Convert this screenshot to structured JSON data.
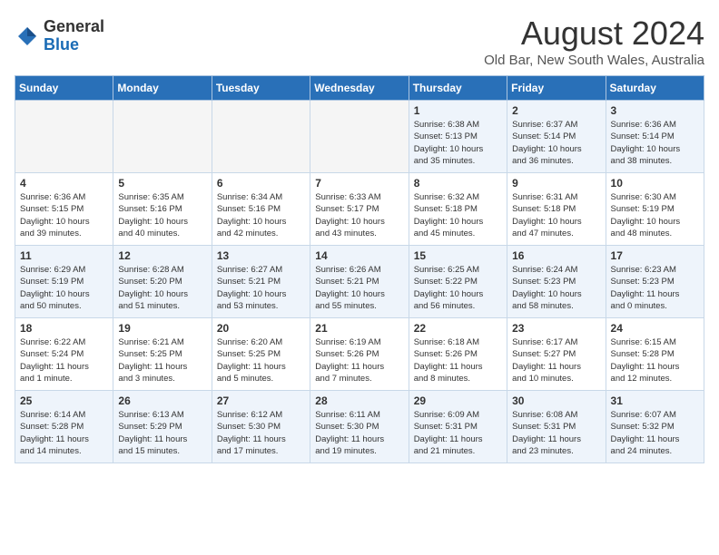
{
  "header": {
    "logo_general": "General",
    "logo_blue": "Blue",
    "month_year": "August 2024",
    "location": "Old Bar, New South Wales, Australia"
  },
  "weekdays": [
    "Sunday",
    "Monday",
    "Tuesday",
    "Wednesday",
    "Thursday",
    "Friday",
    "Saturday"
  ],
  "weeks": [
    [
      {
        "day": "",
        "info": ""
      },
      {
        "day": "",
        "info": ""
      },
      {
        "day": "",
        "info": ""
      },
      {
        "day": "",
        "info": ""
      },
      {
        "day": "1",
        "info": "Sunrise: 6:38 AM\nSunset: 5:13 PM\nDaylight: 10 hours\nand 35 minutes."
      },
      {
        "day": "2",
        "info": "Sunrise: 6:37 AM\nSunset: 5:14 PM\nDaylight: 10 hours\nand 36 minutes."
      },
      {
        "day": "3",
        "info": "Sunrise: 6:36 AM\nSunset: 5:14 PM\nDaylight: 10 hours\nand 38 minutes."
      }
    ],
    [
      {
        "day": "4",
        "info": "Sunrise: 6:36 AM\nSunset: 5:15 PM\nDaylight: 10 hours\nand 39 minutes."
      },
      {
        "day": "5",
        "info": "Sunrise: 6:35 AM\nSunset: 5:16 PM\nDaylight: 10 hours\nand 40 minutes."
      },
      {
        "day": "6",
        "info": "Sunrise: 6:34 AM\nSunset: 5:16 PM\nDaylight: 10 hours\nand 42 minutes."
      },
      {
        "day": "7",
        "info": "Sunrise: 6:33 AM\nSunset: 5:17 PM\nDaylight: 10 hours\nand 43 minutes."
      },
      {
        "day": "8",
        "info": "Sunrise: 6:32 AM\nSunset: 5:18 PM\nDaylight: 10 hours\nand 45 minutes."
      },
      {
        "day": "9",
        "info": "Sunrise: 6:31 AM\nSunset: 5:18 PM\nDaylight: 10 hours\nand 47 minutes."
      },
      {
        "day": "10",
        "info": "Sunrise: 6:30 AM\nSunset: 5:19 PM\nDaylight: 10 hours\nand 48 minutes."
      }
    ],
    [
      {
        "day": "11",
        "info": "Sunrise: 6:29 AM\nSunset: 5:19 PM\nDaylight: 10 hours\nand 50 minutes."
      },
      {
        "day": "12",
        "info": "Sunrise: 6:28 AM\nSunset: 5:20 PM\nDaylight: 10 hours\nand 51 minutes."
      },
      {
        "day": "13",
        "info": "Sunrise: 6:27 AM\nSunset: 5:21 PM\nDaylight: 10 hours\nand 53 minutes."
      },
      {
        "day": "14",
        "info": "Sunrise: 6:26 AM\nSunset: 5:21 PM\nDaylight: 10 hours\nand 55 minutes."
      },
      {
        "day": "15",
        "info": "Sunrise: 6:25 AM\nSunset: 5:22 PM\nDaylight: 10 hours\nand 56 minutes."
      },
      {
        "day": "16",
        "info": "Sunrise: 6:24 AM\nSunset: 5:23 PM\nDaylight: 10 hours\nand 58 minutes."
      },
      {
        "day": "17",
        "info": "Sunrise: 6:23 AM\nSunset: 5:23 PM\nDaylight: 11 hours\nand 0 minutes."
      }
    ],
    [
      {
        "day": "18",
        "info": "Sunrise: 6:22 AM\nSunset: 5:24 PM\nDaylight: 11 hours\nand 1 minute."
      },
      {
        "day": "19",
        "info": "Sunrise: 6:21 AM\nSunset: 5:25 PM\nDaylight: 11 hours\nand 3 minutes."
      },
      {
        "day": "20",
        "info": "Sunrise: 6:20 AM\nSunset: 5:25 PM\nDaylight: 11 hours\nand 5 minutes."
      },
      {
        "day": "21",
        "info": "Sunrise: 6:19 AM\nSunset: 5:26 PM\nDaylight: 11 hours\nand 7 minutes."
      },
      {
        "day": "22",
        "info": "Sunrise: 6:18 AM\nSunset: 5:26 PM\nDaylight: 11 hours\nand 8 minutes."
      },
      {
        "day": "23",
        "info": "Sunrise: 6:17 AM\nSunset: 5:27 PM\nDaylight: 11 hours\nand 10 minutes."
      },
      {
        "day": "24",
        "info": "Sunrise: 6:15 AM\nSunset: 5:28 PM\nDaylight: 11 hours\nand 12 minutes."
      }
    ],
    [
      {
        "day": "25",
        "info": "Sunrise: 6:14 AM\nSunset: 5:28 PM\nDaylight: 11 hours\nand 14 minutes."
      },
      {
        "day": "26",
        "info": "Sunrise: 6:13 AM\nSunset: 5:29 PM\nDaylight: 11 hours\nand 15 minutes."
      },
      {
        "day": "27",
        "info": "Sunrise: 6:12 AM\nSunset: 5:30 PM\nDaylight: 11 hours\nand 17 minutes."
      },
      {
        "day": "28",
        "info": "Sunrise: 6:11 AM\nSunset: 5:30 PM\nDaylight: 11 hours\nand 19 minutes."
      },
      {
        "day": "29",
        "info": "Sunrise: 6:09 AM\nSunset: 5:31 PM\nDaylight: 11 hours\nand 21 minutes."
      },
      {
        "day": "30",
        "info": "Sunrise: 6:08 AM\nSunset: 5:31 PM\nDaylight: 11 hours\nand 23 minutes."
      },
      {
        "day": "31",
        "info": "Sunrise: 6:07 AM\nSunset: 5:32 PM\nDaylight: 11 hours\nand 24 minutes."
      }
    ]
  ]
}
